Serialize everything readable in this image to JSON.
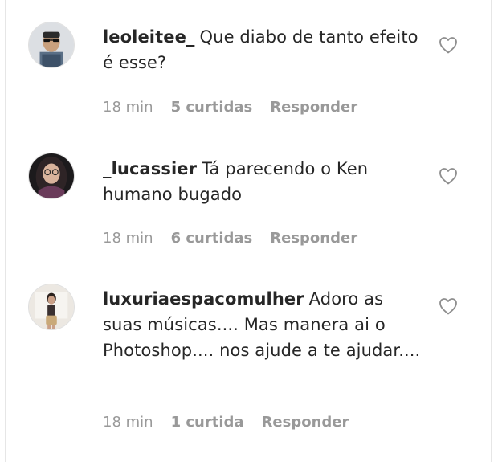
{
  "comments": [
    {
      "username": "leoleitee_",
      "text": "Que diabo de tanto efeito é esse?",
      "time": "18 min",
      "likes": "5 curtidas",
      "reply_label": "Responder",
      "avatar_icon": "user-avatar-sunglasses"
    },
    {
      "username": "_lucassier",
      "text": "Tá parecendo o Ken humano bugado",
      "time": "18 min",
      "likes": "6 curtidas",
      "reply_label": "Responder",
      "avatar_icon": "user-avatar-glasses"
    },
    {
      "username": "luxuriaespacomulher",
      "text": "Adoro as suas músicas.... Mas manera ai o Photoshop.... nos ajude a te ajudar....",
      "time": "18 min",
      "likes": "1 curtida",
      "reply_label": "Responder",
      "avatar_icon": "user-avatar-woman"
    }
  ],
  "colors": {
    "text": "#262626",
    "meta": "#999999",
    "icon": "#8e8e8e"
  },
  "like_icon": "heart-outline-icon"
}
